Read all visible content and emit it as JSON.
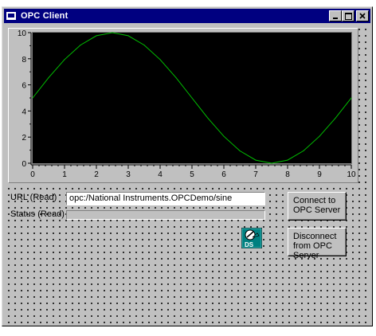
{
  "window": {
    "title": "OPC Client",
    "buttons": {
      "minimize": "_",
      "maximize": "□",
      "close": "×"
    }
  },
  "graph": {
    "y_ticks": [
      "0",
      "2",
      "4",
      "6",
      "8",
      "10"
    ],
    "x_ticks": [
      "0",
      "1",
      "2",
      "3",
      "4",
      "5",
      "6",
      "7",
      "8",
      "9",
      "10"
    ],
    "plot_background": "#000000",
    "trace_color": "#00c000"
  },
  "chart_data": {
    "type": "line",
    "x": [
      0,
      0.5,
      1,
      1.5,
      2,
      2.5,
      3,
      3.5,
      4,
      4.5,
      5,
      5.5,
      6,
      6.5,
      7,
      7.5,
      8,
      8.5,
      9,
      9.5,
      10
    ],
    "series": [
      {
        "values": [
          5.0,
          6.55,
          7.94,
          9.05,
          9.76,
          10.0,
          9.76,
          9.05,
          7.94,
          6.55,
          5.0,
          3.45,
          2.06,
          0.95,
          0.24,
          0.0,
          0.24,
          0.95,
          2.06,
          3.45,
          5.0
        ]
      }
    ],
    "xlim": [
      0,
      10
    ],
    "ylim": [
      0,
      10
    ],
    "grid": false
  },
  "form": {
    "url_label": "URL (Read)",
    "url_value": "opc:/National Instruments.OPCDemo/sine",
    "status_label": "Status (Read)",
    "status_value": ""
  },
  "actions": {
    "connect_label": "Connect to OPC Server",
    "disconnect_label": "Disconnect from OPC Server",
    "ds_icon_text": "DS"
  }
}
